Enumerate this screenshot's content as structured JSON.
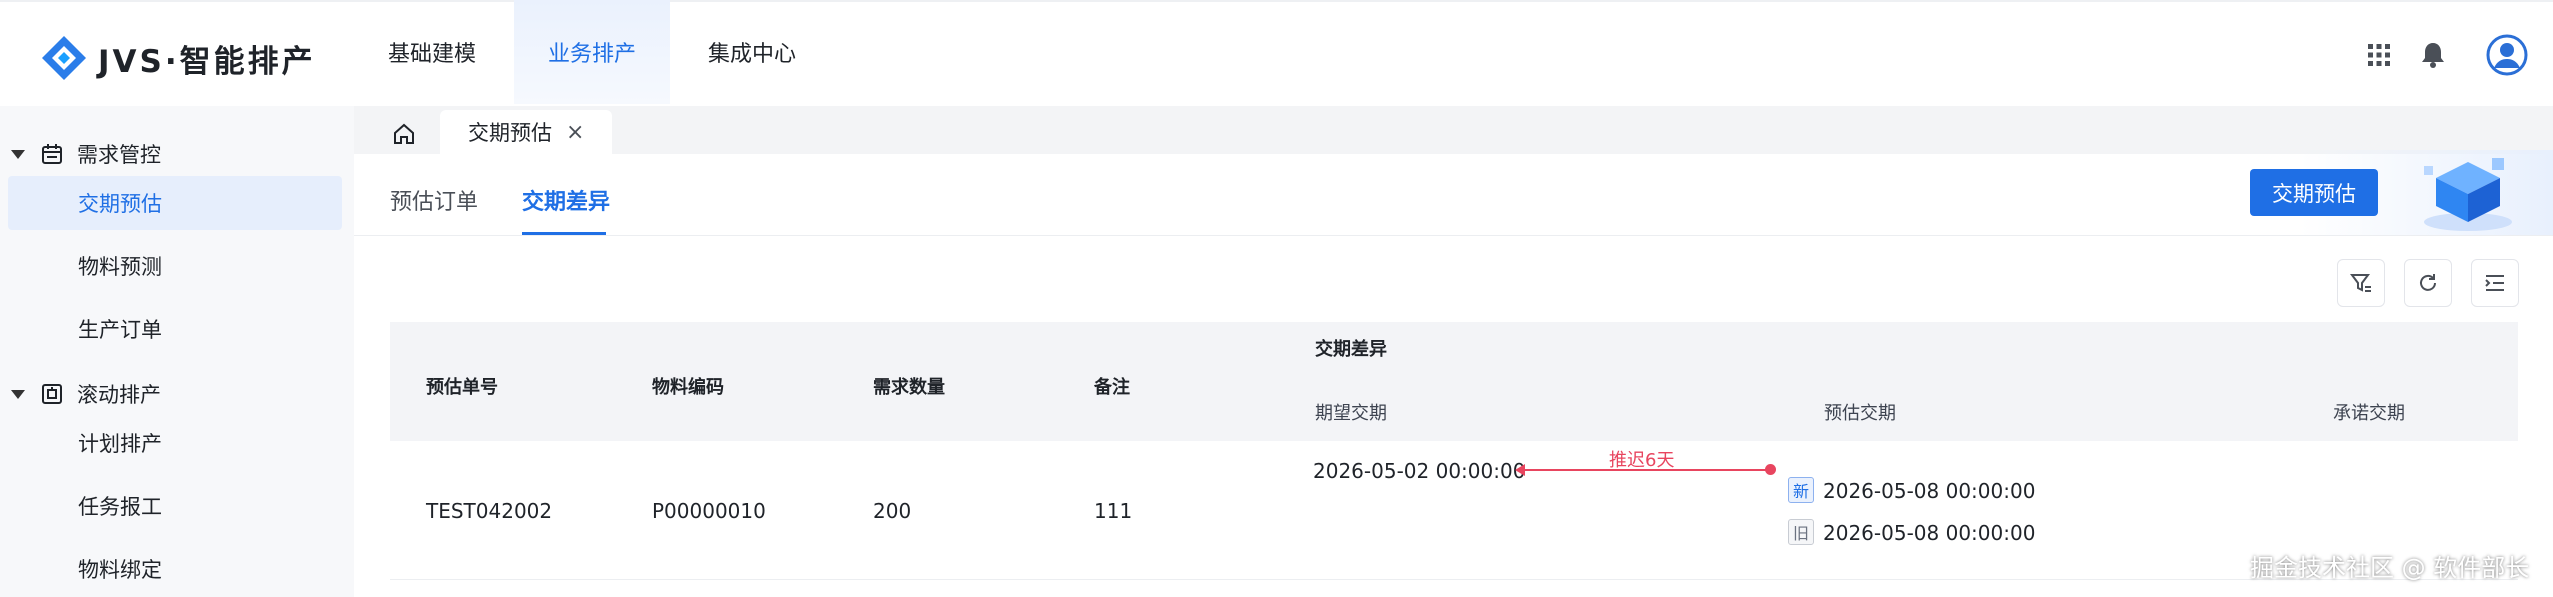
{
  "app": {
    "name": "JVS·智能排产"
  },
  "top_nav": [
    {
      "label": "基础建模",
      "active": false
    },
    {
      "label": "业务排产",
      "active": true
    },
    {
      "label": "集成中心",
      "active": false
    }
  ],
  "top_icons": [
    "grid-icon",
    "bell-icon",
    "user-avatar-icon"
  ],
  "sidebar": {
    "groups": [
      {
        "label": "需求管控",
        "icon": "calendar-icon",
        "expanded": true,
        "items": [
          {
            "label": "交期预估",
            "active": true
          },
          {
            "label": "物料预测",
            "active": false
          },
          {
            "label": "生产订单",
            "active": false
          }
        ]
      },
      {
        "label": "滚动排产",
        "icon": "scroll-icon",
        "expanded": true,
        "items": [
          {
            "label": "计划排产",
            "active": false
          },
          {
            "label": "任务报工",
            "active": false
          },
          {
            "label": "物料绑定",
            "active": false
          }
        ]
      }
    ]
  },
  "page_tabs": {
    "home_icon": "home-icon",
    "open_tab": "交期预估",
    "close_glyph": "×"
  },
  "sub_tabs": [
    {
      "label": "预估订单",
      "active": false
    },
    {
      "label": "交期差异",
      "active": true
    }
  ],
  "primary_action": {
    "label": "交期预估"
  },
  "toolbar": {
    "icons": [
      "filter-icon",
      "refresh-icon",
      "column-settings-icon"
    ]
  },
  "table": {
    "headers": {
      "order_no": "预估单号",
      "material_code": "物料编码",
      "demand_qty": "需求数量",
      "remark": "备注",
      "group": "交期差异",
      "expected": "期望交期",
      "estimated": "预估交期",
      "promised": "承诺交期"
    },
    "rows": [
      {
        "order_no": "TEST042002",
        "material_code": "P00000010",
        "demand_qty": "200",
        "remark": "111",
        "expected": "2026-05-02 00:00:00",
        "delay_label": "推迟6天",
        "estimated_new_tag": "新",
        "estimated_new": "2026-05-08 00:00:00",
        "estimated_old_tag": "旧",
        "estimated_old": "2026-05-08 00:00:00",
        "promised": ""
      }
    ]
  },
  "footer_watermark": "掘金技术社区 @ 软件部长",
  "colors": {
    "primary": "#1f6fe5",
    "delay": "#e8455f",
    "header_bg": "#f3f4f7",
    "sidebar_bg": "#f7f8fa"
  }
}
